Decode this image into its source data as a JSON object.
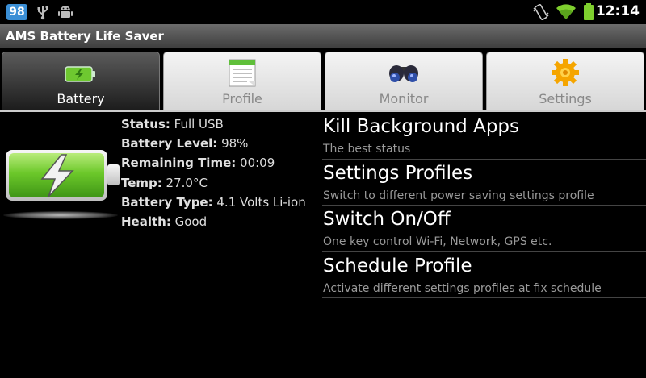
{
  "status_bar": {
    "notification_count": "98",
    "time": "12:14"
  },
  "app": {
    "title": "AMS Battery Life Saver"
  },
  "tabs": [
    {
      "label": "Battery",
      "icon": "battery-icon",
      "active": true
    },
    {
      "label": "Profile",
      "icon": "profile-sheet-icon",
      "active": false
    },
    {
      "label": "Monitor",
      "icon": "binoculars-icon",
      "active": false
    },
    {
      "label": "Settings",
      "icon": "gear-icon",
      "active": false
    }
  ],
  "battery_info": [
    {
      "key": "Status:",
      "value": " Full USB"
    },
    {
      "key": "Battery Level:",
      "value": " 98%"
    },
    {
      "key": "Remaining Time:",
      "value": " 00:09"
    },
    {
      "key": "Temp:",
      "value": " 27.0°C"
    },
    {
      "key": "Battery Type:",
      "value": " 4.1 Volts Li-ion"
    },
    {
      "key": "Health:",
      "value": " Good"
    }
  ],
  "menu": [
    {
      "title": "Kill Background Apps",
      "subtitle": "The best status"
    },
    {
      "title": "Settings Profiles",
      "subtitle": "Switch to different power saving settings profile"
    },
    {
      "title": "Switch On/Off",
      "subtitle": "One key control Wi-Fi, Network, GPS etc."
    },
    {
      "title": "Schedule Profile",
      "subtitle": "Activate different settings profiles at fix schedule"
    }
  ]
}
